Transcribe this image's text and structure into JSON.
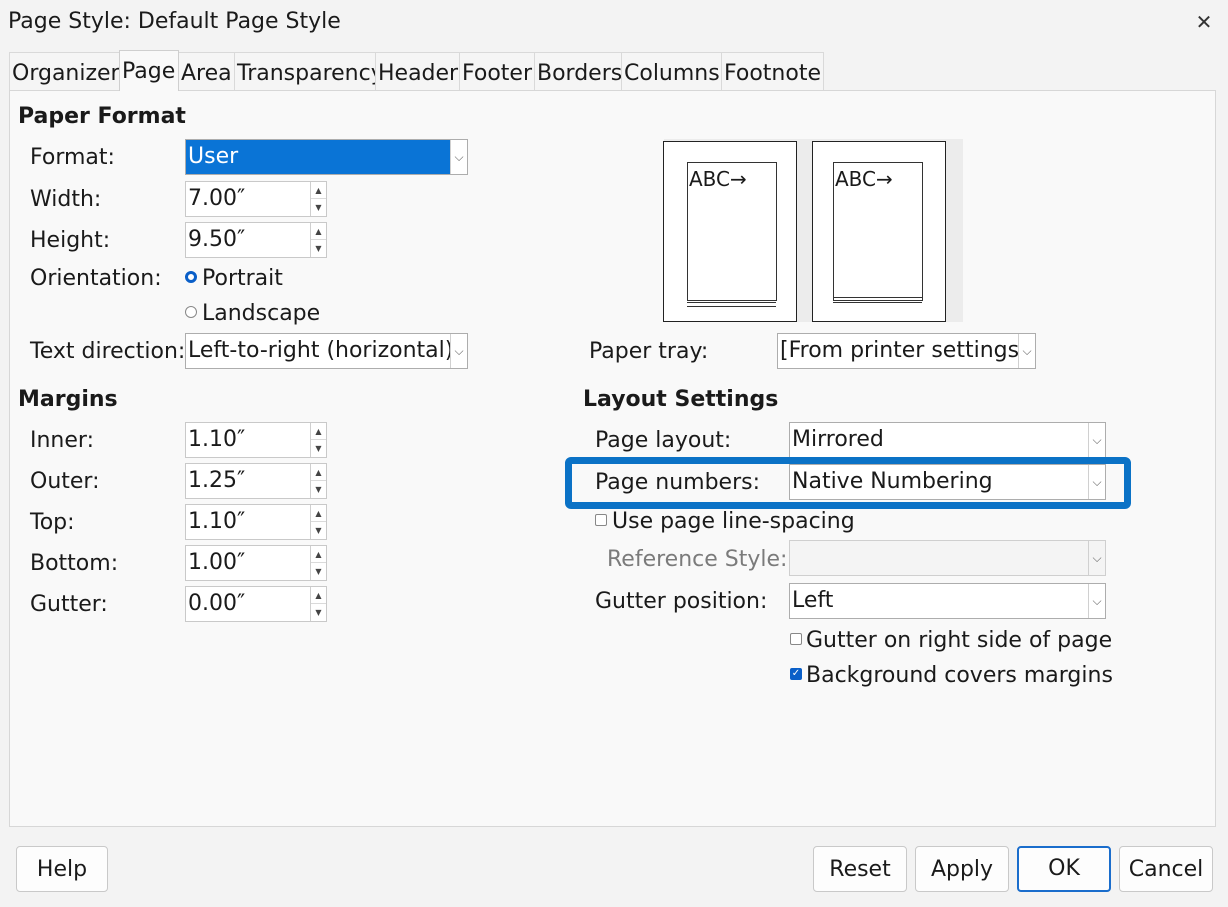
{
  "window": {
    "title": "Page Style: Default Page Style",
    "close_icon": "close-icon"
  },
  "tabs": [
    "Organizer",
    "Page",
    "Area",
    "Transparency",
    "Header",
    "Footer",
    "Borders",
    "Columns",
    "Footnote"
  ],
  "active_tab": "Page",
  "paper_format": {
    "section": "Paper Format",
    "format_label": "Format:",
    "format_value": "User",
    "width_label": "Width:",
    "width_value": "7.00″",
    "height_label": "Height:",
    "height_value": "9.50″",
    "orientation_label": "Orientation:",
    "portrait": "Portrait",
    "landscape": "Landscape",
    "orientation_selected": "Portrait",
    "text_direction_label": "Text direction:",
    "text_direction_value": "Left-to-right (horizontal)"
  },
  "preview": {
    "left_text": "ABC→",
    "right_text": "ABC→"
  },
  "paper_tray": {
    "label": "Paper tray:",
    "value": "[From printer settings]"
  },
  "margins": {
    "section": "Margins",
    "inner_label": "Inner:",
    "inner_value": "1.10″",
    "outer_label": "Outer:",
    "outer_value": "1.25″",
    "top_label": "Top:",
    "top_value": "1.10″",
    "bottom_label": "Bottom:",
    "bottom_value": "1.00″",
    "gutter_label": "Gutter:",
    "gutter_value": "0.00″"
  },
  "layout": {
    "section": "Layout Settings",
    "page_layout_label": "Page layout:",
    "page_layout_value": "Mirrored",
    "page_numbers_label": "Page numbers:",
    "page_numbers_value": "Native Numbering",
    "use_line_spacing": "Use page line-spacing",
    "use_line_spacing_checked": false,
    "reference_style_label": "Reference Style:",
    "reference_style_value": "",
    "gutter_position_label": "Gutter position:",
    "gutter_position_value": "Left",
    "gutter_right": "Gutter on right side of page",
    "gutter_right_checked": false,
    "background_covers": "Background covers margins",
    "background_covers_checked": true
  },
  "buttons": {
    "help": "Help",
    "reset": "Reset",
    "apply": "Apply",
    "ok": "OK",
    "cancel": "Cancel"
  },
  "colors": {
    "accent": "#0a74d6",
    "highlight": "#0b72c6"
  }
}
